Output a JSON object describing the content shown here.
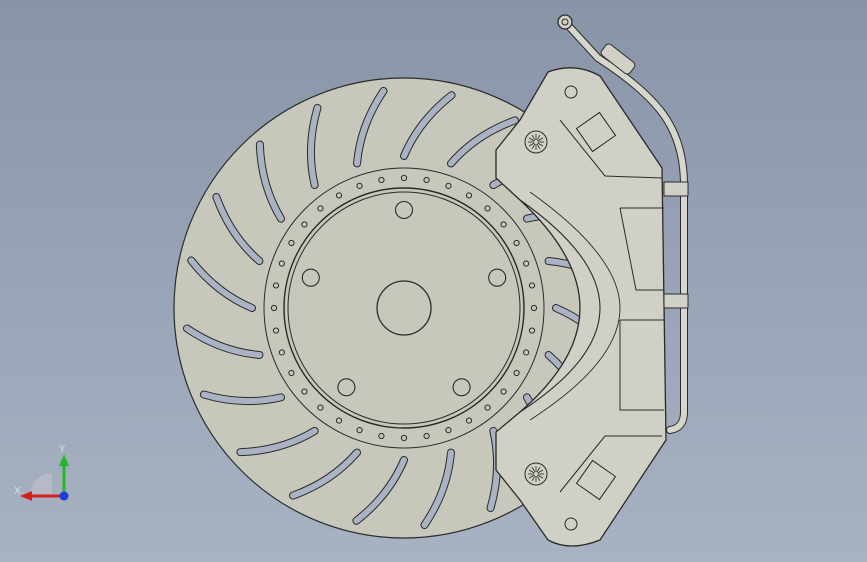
{
  "viewport": {
    "background_top": "#8894a7",
    "background_bottom": "#a7b2c2",
    "model": "brake-disc-and-caliper-assembly"
  },
  "triad": {
    "x_label": "X",
    "y_label": "Y",
    "x_color": "#d81e1e",
    "y_color": "#22b826",
    "z_color": "#1b3fd8"
  },
  "colors": {
    "part_fill": "#c8c7bb",
    "part_edge": "#2a2a2a",
    "caliper_fill": "#d1d0c6"
  }
}
